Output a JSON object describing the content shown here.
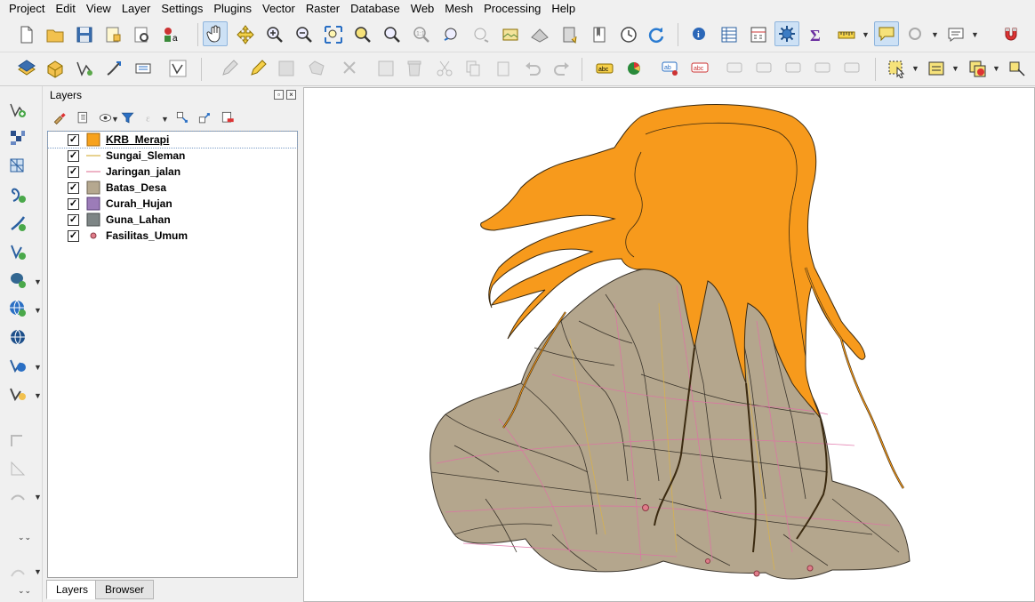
{
  "menubar": {
    "items": [
      "Project",
      "Edit",
      "View",
      "Layer",
      "Settings",
      "Plugins",
      "Vector",
      "Raster",
      "Database",
      "Web",
      "Mesh",
      "Processing",
      "Help"
    ]
  },
  "layers_panel": {
    "title": "Layers",
    "layers": [
      {
        "name": "KRB_Merapi",
        "checked": "✓",
        "symbol": "polygon",
        "color": "#f7a21d"
      },
      {
        "name": "Sungai_Sleman",
        "checked": "✓",
        "symbol": "line",
        "color": "#e0c36a"
      },
      {
        "name": "Jaringan_jalan",
        "checked": "✓",
        "symbol": "line",
        "color": "#e99ab2"
      },
      {
        "name": "Batas_Desa",
        "checked": "✓",
        "symbol": "polygon",
        "color": "#b5a88f"
      },
      {
        "name": "Curah_Hujan",
        "checked": "✓",
        "symbol": "polygon",
        "color": "#9c7cb8"
      },
      {
        "name": "Guna_Lahan",
        "checked": "✓",
        "symbol": "polygon",
        "color": "#7d8585"
      },
      {
        "name": "Fasilitas_Umum",
        "checked": "✓",
        "symbol": "point",
        "color": "#e07d8a"
      }
    ],
    "tabs": [
      "Layers",
      "Browser"
    ]
  },
  "map": {
    "krb_color": "#f79a1c",
    "desa_color": "#b4a68d",
    "road_color": "#e06fa6",
    "river_color": "#d9b24a"
  }
}
